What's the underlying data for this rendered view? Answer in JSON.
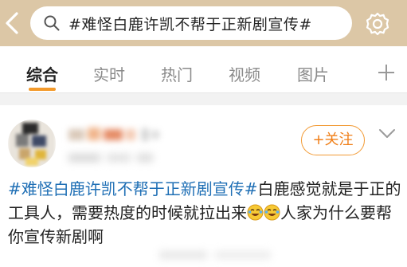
{
  "header": {
    "search_query": "#难怪白鹿许凯不帮于正新剧宣传#",
    "icons": [
      "back-arrow-icon",
      "search-icon",
      "settings-gear-icon"
    ]
  },
  "tabs": [
    {
      "label": "综合",
      "active": true
    },
    {
      "label": "实时",
      "active": false
    },
    {
      "label": "热门",
      "active": false
    },
    {
      "label": "视频",
      "active": false
    },
    {
      "label": "图片",
      "active": false
    }
  ],
  "post": {
    "follow_label": "+关注",
    "hashtag": "#难怪白鹿许凯不帮于正新剧宣传#",
    "text_part1": "白鹿感觉就是于正的工具人，需要热度的时候就拉出来",
    "text_part2": "人家为什么要帮你宣传新剧啊"
  },
  "colors": {
    "header_bg": "#dcc7a6",
    "accent_orange": "#f07f18",
    "hashtag_blue": "#1f6fb5"
  }
}
